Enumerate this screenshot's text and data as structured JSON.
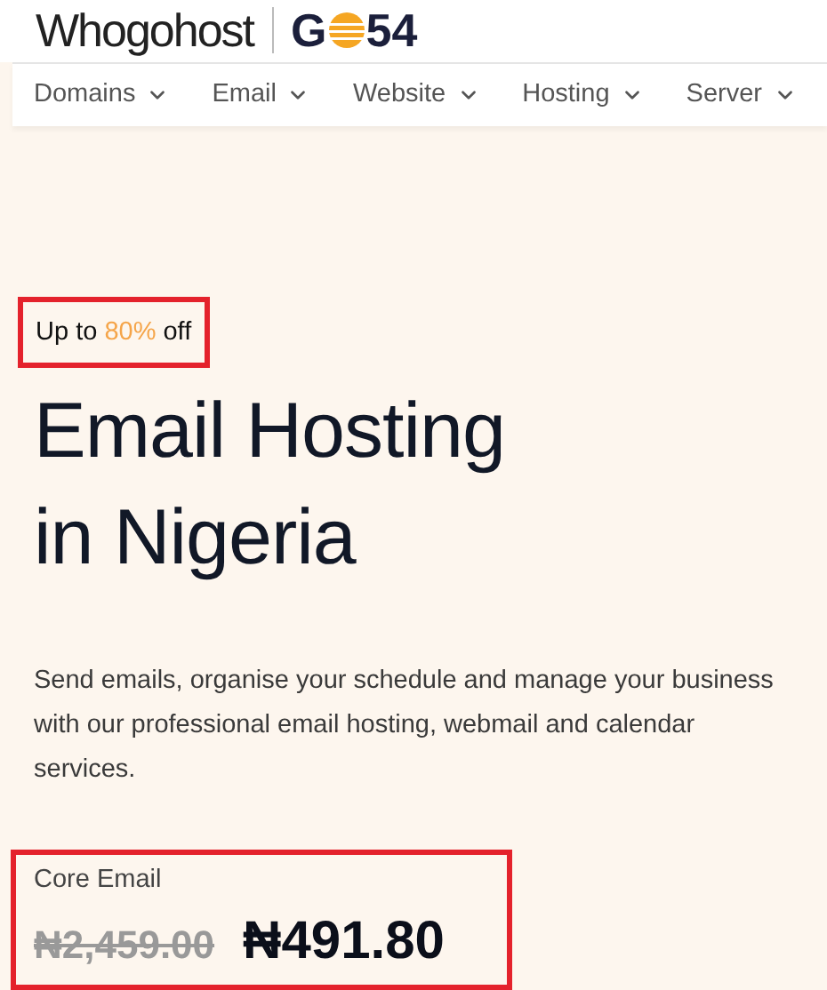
{
  "header": {
    "brand": "Whogohost",
    "partner_logo": {
      "before": "G",
      "after": "54"
    }
  },
  "nav": [
    {
      "label": "Domains"
    },
    {
      "label": "Email"
    },
    {
      "label": "Website"
    },
    {
      "label": "Hosting"
    },
    {
      "label": "Server"
    }
  ],
  "hero": {
    "badge": "Up to **80%** off",
    "title_lines": [
      "Email Hosting",
      "in Nigeria"
    ],
    "description": "Send emails, organise your schedule and manage your business with our professional email hosting, webmail and calendar services.",
    "plan": {
      "name": "Core Email",
      "old_price": "₦2,459.00",
      "price": "₦491.80"
    }
  }
}
